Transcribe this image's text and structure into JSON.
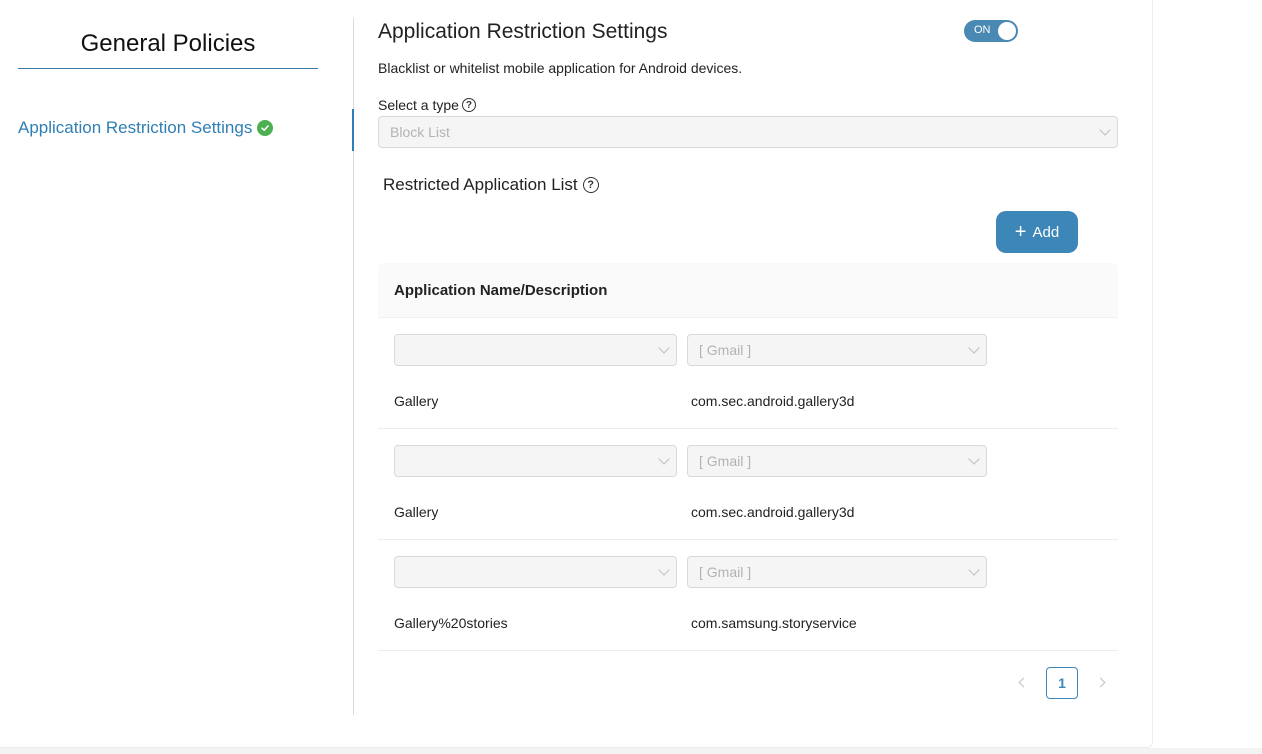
{
  "sidebar": {
    "title": "General Policies",
    "items": [
      {
        "label": "Application Restriction Settings",
        "status": "complete"
      }
    ]
  },
  "main": {
    "title": "Application Restriction Settings",
    "toggle": {
      "label": "ON",
      "state": "on"
    },
    "description": "Blacklist or whitelist mobile application for Android devices.",
    "type_label": "Select a type",
    "type_value": "Block List",
    "list_title": "Restricted Application List",
    "add_label": "Add",
    "table": {
      "column": "Application Name/Description",
      "rows": [
        {
          "select_a": "",
          "select_b_placeholder": "[ Gmail ]",
          "name": "Gallery",
          "package": "com.sec.android.gallery3d"
        },
        {
          "select_a": "",
          "select_b_placeholder": "[ Gmail ]",
          "name": "Gallery",
          "package": "com.sec.android.gallery3d"
        },
        {
          "select_a": "",
          "select_b_placeholder": "[ Gmail ]",
          "name": "Gallery%20stories",
          "package": "com.samsung.storyservice"
        }
      ]
    },
    "pagination": {
      "current_page": "1"
    }
  },
  "colors": {
    "accent": "#3d87b8",
    "link": "#2f7fb5",
    "success": "#4caf50"
  },
  "icons": [
    "check-circle-icon",
    "help-icon",
    "chevron-down-icon",
    "plus-icon",
    "chevron-left-icon",
    "chevron-right-icon"
  ]
}
